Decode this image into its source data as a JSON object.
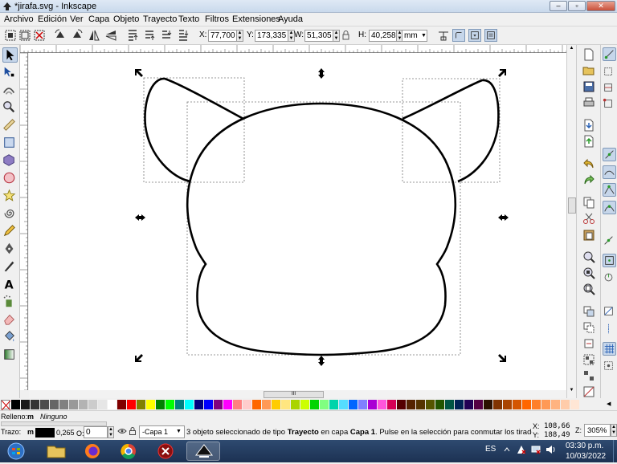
{
  "window": {
    "title": "*jirafa.svg - Inkscape"
  },
  "menu": [
    "Archivo",
    "Edición",
    "Ver",
    "Capa",
    "Objeto",
    "Trayecto",
    "Texto",
    "Filtros",
    "Extensiones",
    "Ayuda"
  ],
  "controls": {
    "x_label": "X:",
    "x_value": "77,700",
    "y_label": "Y:",
    "y_value": "173,335",
    "w_label": "W:",
    "w_value": "51,305",
    "h_label": "H:",
    "h_value": "40,258",
    "unit": "mm"
  },
  "ruler_scroll_label": "III",
  "status": {
    "fill_label": "Relleno:",
    "fill_short": "m",
    "fill_value": "Ninguno",
    "stroke_label": "Trazo:",
    "stroke_short": "m",
    "stroke_width": "0,265",
    "opacity_label": "O:",
    "opacity_value": "0",
    "layer": "-Capa 1",
    "message_parts": [
      "3 objeto seleccionado de tipo ",
      "Trayecto",
      " en capa ",
      "Capa 1",
      ". Pulse en la selección para conmutar los tiradores d..."
    ],
    "cursor_x_label": "X:",
    "cursor_x": "108,66",
    "cursor_y_label": "Y:",
    "cursor_y": "188,49",
    "zoom_label": "Z:",
    "zoom": "305%"
  },
  "taskbar": {
    "language": "ES",
    "time": "03:30 p.m.",
    "date": "10/03/2022",
    "apps": [
      "start-button",
      "file-explorer",
      "firefox",
      "chrome",
      "app-red",
      "inkscape"
    ]
  },
  "colors": {
    "accent": "#c6d6ea",
    "palette": [
      "#000000",
      "#1a1a1a",
      "#333333",
      "#4d4d4d",
      "#666666",
      "#808080",
      "#999999",
      "#b3b3b3",
      "#cccccc",
      "#e6e6e6",
      "#ffffff",
      "#800000",
      "#ff0000",
      "#808000",
      "#ffff00",
      "#008000",
      "#00ff00",
      "#008080",
      "#00ffff",
      "#000080",
      "#0000ff",
      "#800080",
      "#ff00ff",
      "#ff8080",
      "#ffcccc",
      "#ff6600",
      "#ff9955",
      "#ffcc00",
      "#ffe680",
      "#aad400",
      "#ccff00",
      "#00d400",
      "#80ff80",
      "#00d4aa",
      "#55ddff",
      "#0066ff",
      "#8080ff",
      "#aa00d4",
      "#ff55dd",
      "#d40055",
      "#550000",
      "#552200",
      "#553300",
      "#555500",
      "#225500",
      "#005544",
      "#002255",
      "#220055",
      "#550044",
      "#2b1100",
      "#803300",
      "#aa4400",
      "#d45500",
      "#ff6600",
      "#ff7f2a",
      "#ff9955",
      "#ffb380",
      "#ffccaa",
      "#ffe6d5"
    ]
  },
  "icons": {
    "tools_left": [
      "selector-icon",
      "node-icon",
      "tweak-icon",
      "zoom-icon",
      "measure-icon",
      "rectangle-icon",
      "box3d-icon",
      "ellipse-icon",
      "star-icon",
      "spiral-icon",
      "pencil-icon",
      "pen-icon",
      "calligraphy-icon",
      "text-icon",
      "spray-icon",
      "eraser-icon",
      "bucket-icon",
      "gradient-icon"
    ],
    "commands": [
      "new-icon",
      "open-icon",
      "save-icon",
      "print-icon",
      "import-icon",
      "export-icon",
      "undo-icon",
      "redo-icon",
      "copy-icon",
      "cut-icon",
      "paste-icon",
      "zoom-selection-icon",
      "zoom-drawing-icon",
      "zoom-page-icon",
      "duplicate-icon",
      "clone-icon",
      "unlink-clone-icon",
      "group-icon",
      "ungroup-icon",
      "fill-stroke-icon"
    ],
    "snap": [
      "snap-toggle-icon",
      "snap-bbox-icon",
      "snap-bbox-edge-icon",
      "snap-bbox-corner-icon",
      "snap-nodes-icon",
      "snap-path-icon",
      "snap-cusp-icon",
      "snap-smooth-icon",
      "snap-midpoint-icon",
      "snap-center-icon",
      "snap-rotation-icon",
      "snap-page-icon",
      "snap-grid-icon",
      "snap-guide-icon"
    ]
  }
}
